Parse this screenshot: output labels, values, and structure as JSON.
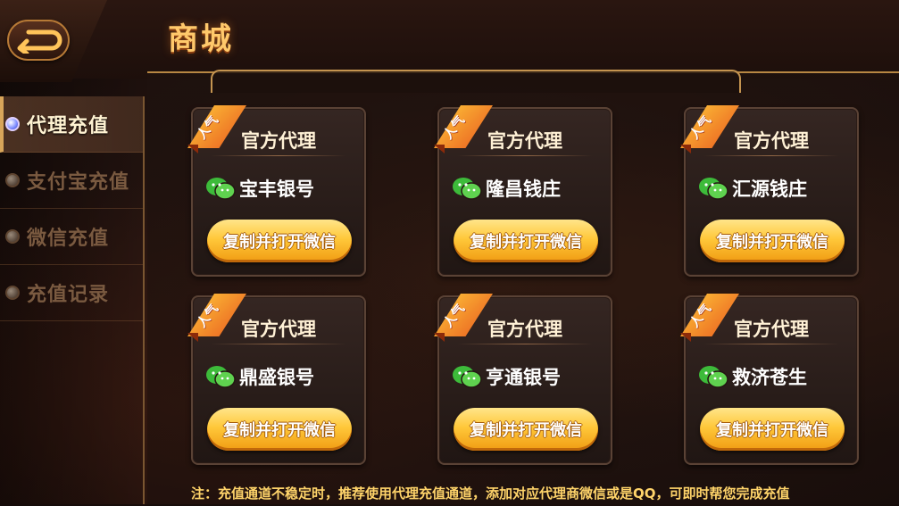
{
  "header": {
    "title": "商城",
    "back_icon": "back-arrow-icon"
  },
  "sidebar": {
    "items": [
      {
        "label": "代理充值",
        "active": true
      },
      {
        "label": "支付宝充值",
        "active": false
      },
      {
        "label": "微信充值",
        "active": false
      },
      {
        "label": "充值记录",
        "active": false
      }
    ]
  },
  "agents": [
    {
      "badge": "人气",
      "title": "官方代理",
      "icon": "wechat-icon",
      "name": "宝丰银号",
      "button": "复制并打开微信"
    },
    {
      "badge": "人气",
      "title": "官方代理",
      "icon": "wechat-icon",
      "name": "隆昌钱庄",
      "button": "复制并打开微信"
    },
    {
      "badge": "人气",
      "title": "官方代理",
      "icon": "wechat-icon",
      "name": "汇源钱庄",
      "button": "复制并打开微信"
    },
    {
      "badge": "人气",
      "title": "官方代理",
      "icon": "wechat-icon",
      "name": "鼎盛银号",
      "button": "复制并打开微信"
    },
    {
      "badge": "人气",
      "title": "官方代理",
      "icon": "wechat-icon",
      "name": "亨通银号",
      "button": "复制并打开微信"
    },
    {
      "badge": "人气",
      "title": "官方代理",
      "icon": "wechat-icon",
      "name": "救济苍生",
      "button": "复制并打开微信"
    }
  ],
  "footer": {
    "note": "注：充值通道不稳定时，推荐使用代理充值通道，添加对应代理商微信或是QQ，可即时帮您完成充值"
  },
  "colors": {
    "title_gold": "#ffc96b",
    "button_gold": "#ffc83a",
    "ribbon_orange": "#e8551e",
    "wechat_green": "#3dbb3a",
    "active_dot": "#7c8bff"
  }
}
